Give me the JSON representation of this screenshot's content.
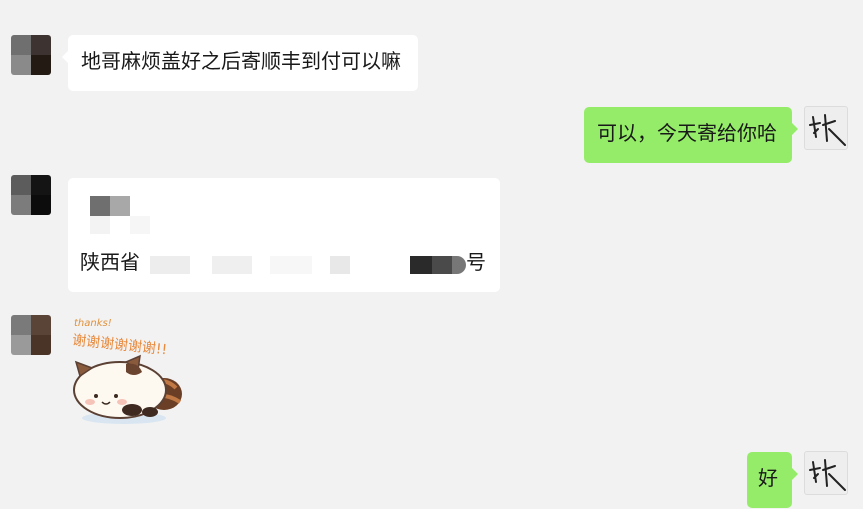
{
  "top_fragment": "···",
  "messages": [
    {
      "side": "left",
      "text": "地哥麻烦盖好之后寄顺丰到付可以嘛"
    },
    {
      "side": "right",
      "text": "可以，今天寄给你哈"
    },
    {
      "side": "left",
      "type": "address",
      "prefix": "陕西省",
      "suffix": "号"
    },
    {
      "side": "left",
      "type": "sticker",
      "caption": "thanks!",
      "sticker_text": "谢谢谢谢谢谢!!"
    },
    {
      "side": "right",
      "text": "好"
    }
  ],
  "self_avatar_text": "秋",
  "colors": {
    "background": "#f2f2f2",
    "bubble_left": "#ffffff",
    "bubble_right": "#95ec69"
  }
}
